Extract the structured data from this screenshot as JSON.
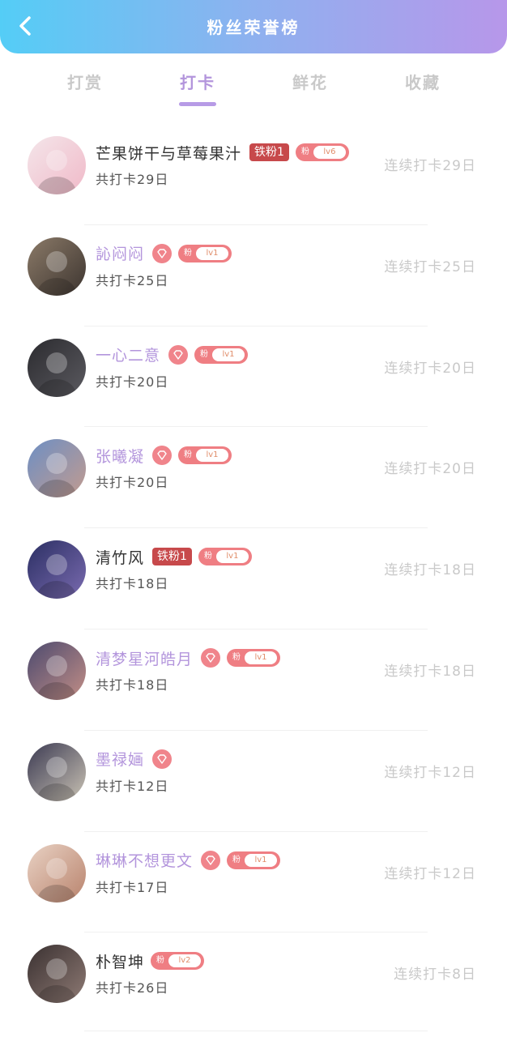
{
  "header": {
    "title": "粉丝荣誉榜",
    "back_icon": "chevron-left-icon"
  },
  "tabs": [
    {
      "label": "打赏",
      "active": false
    },
    {
      "label": "打卡",
      "active": true
    },
    {
      "label": "鲜花",
      "active": false
    },
    {
      "label": "收藏",
      "active": false
    }
  ],
  "colors": {
    "accent": "#b395dc",
    "badge_red": "#c7494b",
    "pill_pink": "#ef7e83"
  },
  "fan_pill_label": "粉",
  "rows": [
    {
      "name": "芒果饼干与草莓果汁",
      "name_purple": false,
      "badge_type": "iron",
      "badge_text": "铁粉1",
      "pill_level": "lv6",
      "total": "共打卡29日",
      "streak": "连续打卡29日",
      "avatar_colors": [
        "#f4e6ea",
        "#f0b9c8"
      ]
    },
    {
      "name": "訫闷闷",
      "name_purple": true,
      "badge_type": "diamond",
      "badge_text": "",
      "pill_level": "lv1",
      "total": "共打卡25日",
      "streak": "连续打卡25日",
      "avatar_colors": [
        "#8b7a68",
        "#3d3530"
      ]
    },
    {
      "name": "一心二意",
      "name_purple": true,
      "badge_type": "diamond",
      "badge_text": "",
      "pill_level": "lv1",
      "total": "共打卡20日",
      "streak": "连续打卡20日",
      "avatar_colors": [
        "#2b2b2f",
        "#5b5a60"
      ]
    },
    {
      "name": "张曦凝",
      "name_purple": true,
      "badge_type": "diamond",
      "badge_text": "",
      "pill_level": "lv1",
      "total": "共打卡20日",
      "streak": "连续打卡20日",
      "avatar_colors": [
        "#6d8fc4",
        "#c29b8f"
      ]
    },
    {
      "name": "清竹风",
      "name_purple": false,
      "badge_type": "iron",
      "badge_text": "铁粉1",
      "pill_level": "lv1",
      "total": "共打卡18日",
      "streak": "连续打卡18日",
      "avatar_colors": [
        "#2b2f63",
        "#7a6bb0"
      ]
    },
    {
      "name": "清梦星河皓月",
      "name_purple": true,
      "badge_type": "diamond",
      "badge_text": "",
      "pill_level": "lv1",
      "total": "共打卡18日",
      "streak": "连续打卡18日",
      "avatar_colors": [
        "#4c4a6f",
        "#c28e86"
      ]
    },
    {
      "name": "墨禄婳",
      "name_purple": true,
      "badge_type": "diamond",
      "badge_text": "",
      "pill_level": "",
      "total": "共打卡12日",
      "streak": "连续打卡12日",
      "avatar_colors": [
        "#3b3a52",
        "#c9c2b4"
      ]
    },
    {
      "name": "琳琳不想更文",
      "name_purple": true,
      "badge_type": "diamond",
      "badge_text": "",
      "pill_level": "lv1",
      "total": "共打卡17日",
      "streak": "连续打卡12日",
      "avatar_colors": [
        "#e9d2c4",
        "#b9836d"
      ]
    },
    {
      "name": "朴智坤",
      "name_purple": false,
      "badge_type": "none",
      "badge_text": "",
      "pill_level": "lv2",
      "total": "共打卡26日",
      "streak": "连续打卡8日",
      "avatar_colors": [
        "#3a3131",
        "#8e7a74"
      ]
    }
  ]
}
